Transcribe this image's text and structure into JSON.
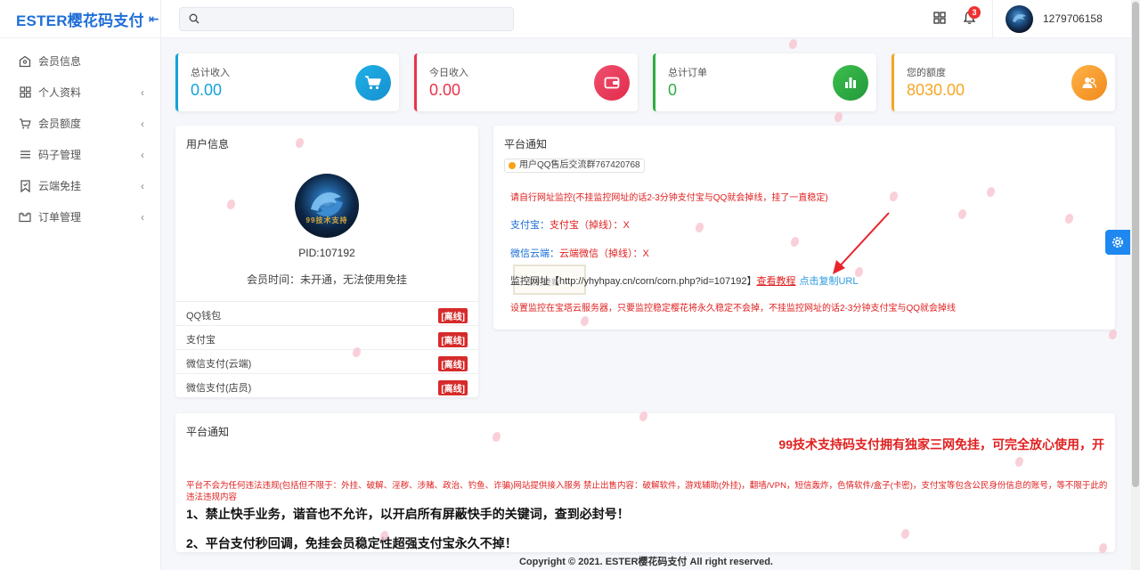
{
  "brand": {
    "name": "ESTER樱花码支付",
    "collapse_icon": "collapse-left-icon"
  },
  "sidebar": {
    "items": [
      {
        "label": "会员信息",
        "icon": "user-icon",
        "has_submenu": false
      },
      {
        "label": "个人资料",
        "icon": "grid-icon",
        "has_submenu": true
      },
      {
        "label": "会员额度",
        "icon": "cart-icon",
        "has_submenu": true
      },
      {
        "label": "码子管理",
        "icon": "list-icon",
        "has_submenu": true
      },
      {
        "label": "云端免挂",
        "icon": "bookmark-icon",
        "has_submenu": true
      },
      {
        "label": "订单管理",
        "icon": "folder-icon",
        "has_submenu": true
      }
    ]
  },
  "header": {
    "search_value": "",
    "notification_count": "3",
    "username": "1279706158"
  },
  "stats": [
    {
      "label": "总计收入",
      "value": "0.00",
      "color": "#17a2d8",
      "icon": "cart-icon"
    },
    {
      "label": "今日收入",
      "value": "0.00",
      "color": "#e8334a",
      "icon": "wallet-icon"
    },
    {
      "label": "总计订单",
      "value": "0",
      "color": "#2eae3f",
      "icon": "bar-chart-icon"
    },
    {
      "label": "您的额度",
      "value": "8030.00",
      "color": "#f5a623",
      "icon": "users-icon"
    }
  ],
  "user_info": {
    "title": "用户信息",
    "pid": "PID:107192",
    "member_time": "会员时间：未开通，无法使用免挂",
    "avatar_text": "99技术支持",
    "payments": [
      {
        "label": "QQ钱包",
        "status": "[离线]"
      },
      {
        "label": "支付宝",
        "status": "[离线]"
      },
      {
        "label": "微信支付(云端)",
        "status": "[离线]"
      },
      {
        "label": "微信支付(店员)",
        "status": "[离线]"
      }
    ]
  },
  "platform_notice": {
    "title": "平台通知",
    "tag": "用户QQ售后交流群767420768",
    "line1": "请自行网址监控(不挂监控网址的话2-3分钟支付宝与QQ就会掉线，挂了一直稳定)",
    "alipay_label": "支付宝：",
    "alipay_status": "支付宝（掉线）：X",
    "wechat_label": "微信云端：",
    "wechat_status": "云端微信（掉线）：X",
    "monitor_label": "监控网址【http://yhyhpay.cn/corn/corn.php?id=107192】",
    "tutorial_link": "查看教程",
    "copy_url": "点击复制URL",
    "ghost_text": "实时更新",
    "line_bottom": "设置监控在宝塔云服务器，只要监控稳定樱花将永久稳定不会掉，不挂监控网址的话2-3分钟支付宝与QQ就会掉线"
  },
  "bottom_notice": {
    "title": "平台通知",
    "headline": "99技术支持码支付拥有独家三网免挂，可完全放心使用，开",
    "disclaimer": "平台不会为任何违法违规(包括但不限于：外挂、破解、淫秽、涉赌、政治、钓鱼、诈骗)网站提供接入服务 禁止出售内容：破解软件，游戏辅助(外挂)，翻墙/VPN，短信轰炸，色情软件/盒子(卡密)，支付宝等包含公民身份信息的账号，等不限于此的违法违规内容",
    "rule1": "1、禁止快手业务，谐音也不允许，以开启所有屏蔽快手的关键词，查到必封号！",
    "rule2": "2、平台支付秒回调，免挂会员稳定性超强支付宝永久不掉！"
  },
  "footer": {
    "text": "Copyright © 2021. ESTER樱花码支付 All right reserved."
  }
}
